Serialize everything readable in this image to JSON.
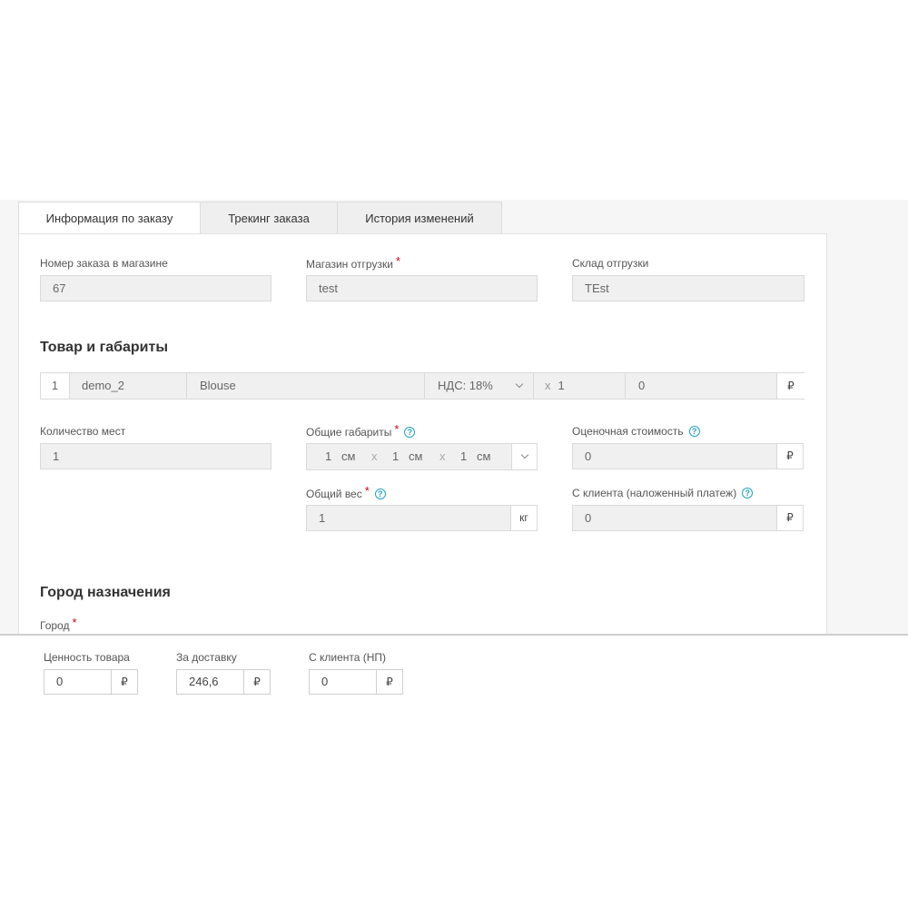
{
  "tabs": [
    "Информация по заказу",
    "Трекинг заказа",
    "История изменений"
  ],
  "order": {
    "order_no_label": "Номер заказа в магазине",
    "order_no": "67",
    "shop_label": "Магазин отгрузки",
    "shop": "test",
    "warehouse_label": "Склад отгрузки",
    "warehouse": "TEst"
  },
  "goods": {
    "title": "Товар и габариты",
    "item": {
      "index": "1",
      "sku": "demo_2",
      "name": "Blouse",
      "vat": "НДС: 18%",
      "qty_prefix": "x",
      "qty": "1",
      "price": "0",
      "currency": "₽"
    },
    "places_label": "Количество мест",
    "places": "1",
    "dims_label": "Общие габариты",
    "dims": {
      "a": "1",
      "b": "1",
      "c": "1",
      "unit": "см",
      "sep": "x"
    },
    "weight_label": "Общий вес",
    "weight": "1",
    "weight_unit": "кг",
    "declared_label": "Оценочная стоимость",
    "declared": "0",
    "cod_label": "С клиента (наложенный платеж)",
    "cod": "0"
  },
  "destination": {
    "title": "Город назначения",
    "city_label": "Город"
  },
  "footer": {
    "value_label": "Ценность товара",
    "value": "0",
    "delivery_label": "За доставку",
    "delivery": "246,6",
    "client_label": "С клиента (НП)",
    "client": "0",
    "currency": "₽"
  },
  "help_glyph": "?",
  "required_glyph": "*"
}
